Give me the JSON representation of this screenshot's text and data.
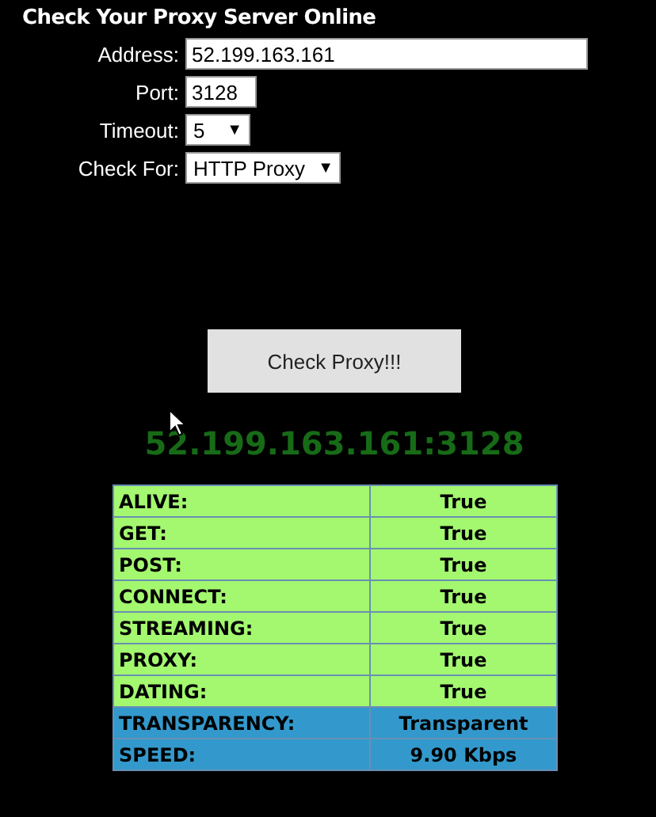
{
  "title": "Check Your Proxy Server Online",
  "form": [
    {
      "kind": "text",
      "label": "Address:",
      "value": "52.199.163.161"
    },
    {
      "kind": "text",
      "label": "Port:",
      "value": "3128"
    },
    {
      "kind": "select",
      "label": "Timeout:",
      "value": "5",
      "arrow": "▼"
    },
    {
      "kind": "select",
      "label": "Check For:",
      "value": "HTTP Proxy",
      "arrow": "▼"
    }
  ],
  "button": "Check Proxy!!!",
  "result": "52.199.163.161:3128",
  "rows": [
    {
      "label": "ALIVE:",
      "value": "True",
      "color": "#a3f86f"
    },
    {
      "label": "GET:",
      "value": "True",
      "color": "#a3f86f"
    },
    {
      "label": "POST:",
      "value": "True",
      "color": "#a3f86f"
    },
    {
      "label": "CONNECT:",
      "value": "True",
      "color": "#a3f86f"
    },
    {
      "label": "STREAMING:",
      "value": "True",
      "color": "#a3f86f"
    },
    {
      "label": "PROXY:",
      "value": "True",
      "color": "#a3f86f"
    },
    {
      "label": "DATING:",
      "value": "True",
      "color": "#a3f86f"
    },
    {
      "label": "TRANSPARENCY:",
      "value": "Transparent",
      "color": "#3399cc"
    },
    {
      "label": "SPEED:",
      "value": "9.90 Kbps",
      "color": "#3399cc"
    }
  ]
}
